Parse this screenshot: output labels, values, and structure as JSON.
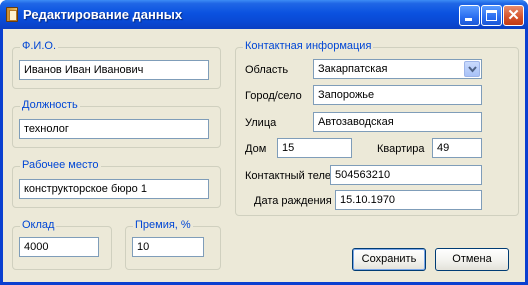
{
  "window": {
    "title": "Редактирование данных",
    "icons": {
      "app": "notebook-icon",
      "minimize": "minimize-icon",
      "maximize": "maximize-icon",
      "close": "close-icon"
    },
    "close_glyph": "✕"
  },
  "fio": {
    "group_title": "Ф.И.О.",
    "value": "Иванов Иван Иванович"
  },
  "position": {
    "group_title": "Должность",
    "value": "технолог"
  },
  "workplace": {
    "group_title": "Рабочее место",
    "value": "конструкторское бюро 1"
  },
  "salary": {
    "group_title": "Оклад",
    "value": "4000"
  },
  "bonus": {
    "group_title": "Премия, %",
    "value": "10"
  },
  "contact": {
    "group_title": "Контактная информация",
    "region": {
      "label": "Область",
      "value": "Закарпатская"
    },
    "city": {
      "label": "Город/село",
      "value": "Запорожье"
    },
    "street": {
      "label": "Улица",
      "value": "Автозаводская"
    },
    "house": {
      "label": "Дом",
      "value": "15"
    },
    "apartment": {
      "label": "Квартира",
      "value": "49"
    },
    "phone": {
      "label": "Контактный телефон",
      "value": "504563210"
    },
    "birthdate": {
      "label": "Дата раждения",
      "value": "15.10.1970"
    }
  },
  "buttons": {
    "save": "Сохранить",
    "cancel": "Отмена"
  },
  "colors": {
    "titlebar": "#0b52e0",
    "client": "#ece9d8",
    "group_title": "#0046d5",
    "field_border": "#7f9db9"
  }
}
